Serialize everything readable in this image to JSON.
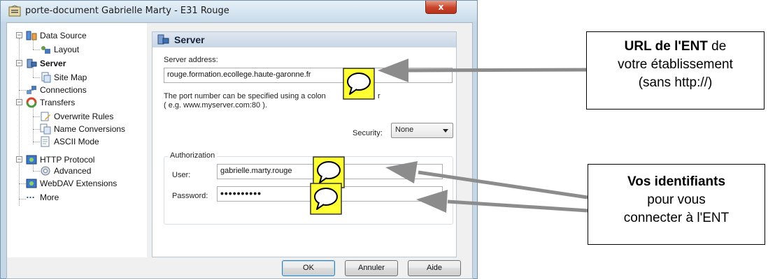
{
  "window": {
    "title": "porte-document Gabrielle Marty - E31 Rouge",
    "close_glyph": "x"
  },
  "tree": {
    "items": [
      {
        "label": "Data Source",
        "icon": "data-source-icon"
      },
      {
        "label": "Layout",
        "icon": "layout-icon"
      },
      {
        "label": "Server",
        "icon": "server-icon",
        "selected": true
      },
      {
        "label": "Site Map",
        "icon": "site-map-icon"
      },
      {
        "label": "Connections",
        "icon": "connections-icon"
      },
      {
        "label": "Transfers",
        "icon": "transfers-icon"
      },
      {
        "label": "Overwrite Rules",
        "icon": "overwrite-rules-icon"
      },
      {
        "label": "Name Conversions",
        "icon": "name-conversions-icon"
      },
      {
        "label": "ASCII Mode",
        "icon": "ascii-mode-icon"
      },
      {
        "label": "HTTP Protocol",
        "icon": "http-protocol-icon"
      },
      {
        "label": "Advanced",
        "icon": "advanced-icon"
      },
      {
        "label": "WebDAV Extensions",
        "icon": "webdav-icon"
      },
      {
        "label": "More",
        "icon": "more-icon"
      }
    ]
  },
  "pane": {
    "title": "Server",
    "server_address_label": "Server address:",
    "server_address_value": "rouge.formation.ecollege.haute-garonne.fr",
    "port_hint_line1": "The port number can be specified using a colon",
    "port_hint_tail": "r",
    "port_hint_line2": "( e.g. www.myserver.com:80 ).",
    "security_label": "Security:",
    "security_value": "None",
    "authorization_legend": "Authorization",
    "user_label": "User:",
    "user_value": "gabrielle.marty.rouge",
    "password_label": "Password:",
    "password_value": "••••••••••"
  },
  "buttons": {
    "ok": "OK",
    "cancel": "Annuler",
    "help": "Aide"
  },
  "callouts": {
    "url_bold": "URL de l'ENT",
    "url_rest1": " de",
    "url_line2": "votre établissement",
    "url_line3": "(sans http://)",
    "ids_bold": "Vos identifiants",
    "ids_line2": "pour vous",
    "ids_line3": "connecter à l'ENT"
  },
  "colors": {
    "bubble_fill": "#ffff33",
    "arrow_gray": "#8c8c8c",
    "window_frame": "#c6d8e8"
  }
}
